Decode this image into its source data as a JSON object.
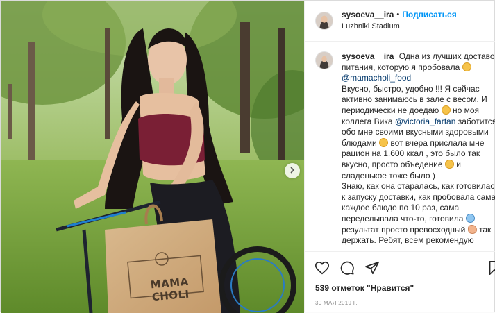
{
  "post": {
    "username": "sysoeva__ira",
    "separator": "•",
    "follow_label": "Подписаться",
    "location": "Luzhniki Stadium",
    "bag_brand": "MAMA CHOLI",
    "caption": {
      "username": "sysoeva__ira",
      "p1": "Одна из лучших доставок питания, которую я пробовала",
      "mention1": "@mamacholi_food",
      "p2": "Вкусно, быстро, удобно !!! Я сейчас активно занимаюсь в зале с весом. И периодически не доедаю",
      "p3": "но моя коллега Вика",
      "mention2": "@victoria_farfan",
      "p4": "заботится обо мне своими вкусными здоровыми блюдами",
      "p5": "вот вчера прислала мне рацион на 1.600 ккал , это было так вкусно, просто объедение",
      "p6": "и сладенькое тоже было )",
      "p7": "Знаю, как она старалась, как готовилась к запуску доставки, как пробовала сама каждое блюдо по 10 раз, сама переделывала что-то, готовила",
      "p8": "результат просто превосходный",
      "p9": "так держать.",
      "p10": "Ребят, всем рекомендую"
    },
    "likes_text": "539 отметок \"Нравится\"",
    "date_text": "30 МАЯ 2019 Г.",
    "icons": [
      "heart-icon",
      "comment-icon",
      "share-icon",
      "bookmark-icon",
      "chevron-right-icon"
    ],
    "colors": {
      "follow": "#0095f6",
      "mention": "#00376b",
      "date": "#8e8e8e",
      "border": "#dbdbdb"
    }
  }
}
